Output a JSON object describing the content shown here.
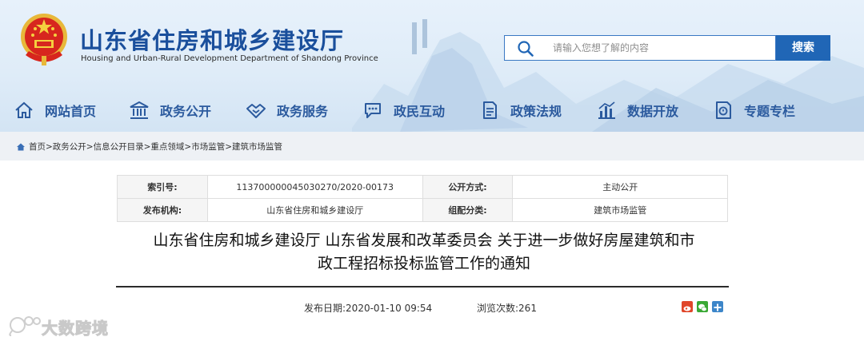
{
  "site": {
    "title": "山东省住房和城乡建设厅",
    "subtitle": "Housing and Urban-Rural Development Department of Shandong Province",
    "emblem_icon": "national-emblem-icon"
  },
  "search": {
    "placeholder": "请输入您想了解的内容",
    "button_label": "搜索",
    "icon": "search-icon"
  },
  "nav": {
    "items": [
      {
        "label": "网站首页",
        "icon": "home-icon"
      },
      {
        "label": "政务公开",
        "icon": "government-building-icon"
      },
      {
        "label": "政务服务",
        "icon": "handshake-icon"
      },
      {
        "label": "政民互动",
        "icon": "chat-bubble-icon"
      },
      {
        "label": "政策法规",
        "icon": "document-icon"
      },
      {
        "label": "数据开放",
        "icon": "bar-chart-icon"
      },
      {
        "label": "专题专栏",
        "icon": "topic-icon"
      }
    ]
  },
  "breadcrumb": {
    "icon": "home-icon",
    "text": "首页>政务公开>信息公开目录>重点领域>市场监管>建筑市场监管"
  },
  "meta": {
    "index_label": "索引号:",
    "index_value": "113700000045030270/2020-00173",
    "disclosure_label": "公开方式:",
    "disclosure_value": "主动公开",
    "issuer_label": "发布机构:",
    "issuer_value": "山东省住房和城乡建设厅",
    "category_label": "组配分类:",
    "category_value": "建筑市场监管"
  },
  "article": {
    "title_line1": "山东省住房和城乡建设厅 山东省发展和改革委员会 关于进一步做好房屋建筑和市",
    "title_line2": "政工程招标投标监管工作的通知",
    "publish_date": "发布日期:2020-01-10 09:54",
    "views": "浏览次数:261"
  },
  "share": {
    "icons": [
      "weibo-share-icon",
      "wechat-share-icon",
      "more-share-icon"
    ],
    "colors": [
      "#e0462a",
      "#3aa935",
      "#3d86c9"
    ]
  },
  "watermark": {
    "text": "大数跨境",
    "icon": "watermark-logo-icon"
  },
  "colors": {
    "brand_blue": "#1a4f9c",
    "search_button": "#2066b6",
    "nav_text": "#2b5a9e"
  }
}
